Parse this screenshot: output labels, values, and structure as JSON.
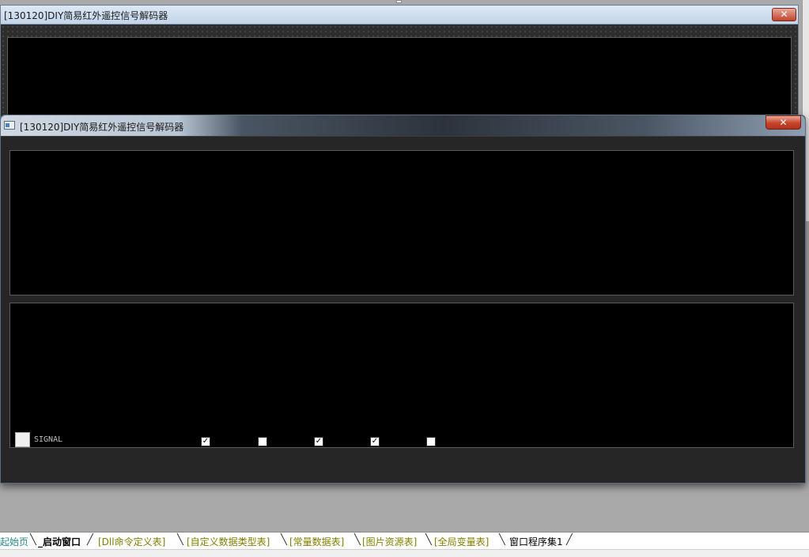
{
  "window_back": {
    "title": "[130120]DIY简易红外遥控信号解码器",
    "close_label": "✕"
  },
  "window_front": {
    "title": "[130120]DIY简易红外遥控信号解码器",
    "close_label": "✕",
    "signal_label": "SIGNAL",
    "checkboxes": [
      {
        "checked": true,
        "glyph": "✓"
      },
      {
        "checked": false,
        "glyph": ""
      },
      {
        "checked": true,
        "glyph": "✓"
      },
      {
        "checked": true,
        "glyph": "✓"
      },
      {
        "checked": false,
        "glyph": ""
      }
    ]
  },
  "tabs": [
    {
      "label": "起始页",
      "state": "home"
    },
    {
      "label": "_启动窗口",
      "state": "active"
    },
    {
      "label": "[Dll命令定义表]",
      "state": "table"
    },
    {
      "label": "[自定义数据类型表]",
      "state": "table"
    },
    {
      "label": "[常量数据表]",
      "state": "table"
    },
    {
      "label": "[图片资源表]",
      "state": "table"
    },
    {
      "label": "[全局变量表]",
      "state": "table"
    },
    {
      "label": "窗口程序集1",
      "state": "normal"
    }
  ],
  "colors": {
    "workspace": "#a9a9a9",
    "window_body": "#262626",
    "panel": "#000000",
    "close_red": "#c7432a",
    "tab_table_text": "#808000",
    "tab_home_text": "#2a8a8a"
  }
}
